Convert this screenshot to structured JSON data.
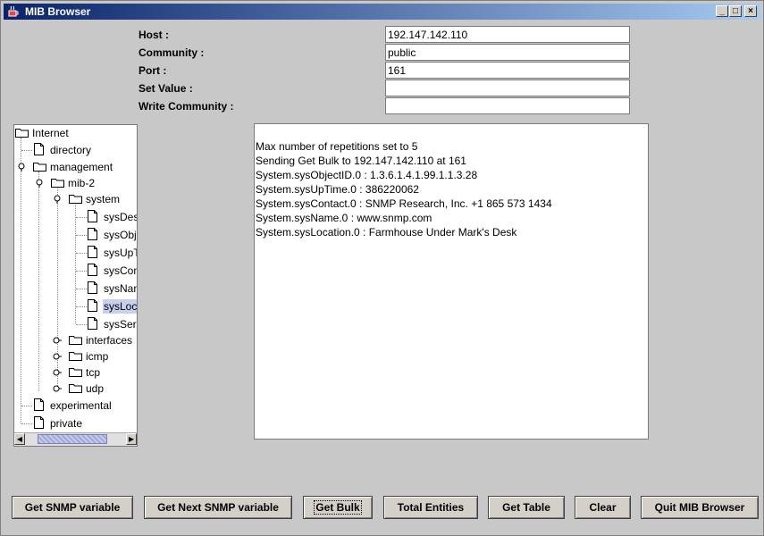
{
  "window": {
    "title": "MIB Browser"
  },
  "form": {
    "host_label": "Host :",
    "host_value": "192.147.142.110",
    "community_label": "Community :",
    "community_value": "public",
    "port_label": "Port :",
    "port_value": "161",
    "set_value_label": "Set Value :",
    "set_value_value": "",
    "write_community_label": "Write Community :",
    "write_community_value": ""
  },
  "tree": {
    "internet": "Internet",
    "directory": "directory",
    "management": "management",
    "mib2": "mib-2",
    "system": "system",
    "system_children": [
      "sysDes",
      "sysObj",
      "sysUpT",
      "sysCon",
      "sysNan",
      "sysLoc",
      "sysSer"
    ],
    "selected": "sysLoc",
    "interfaces": "interfaces",
    "icmp": "icmp",
    "tcp": "tcp",
    "udp": "udp",
    "experimental": "experimental",
    "private": "private"
  },
  "output": {
    "lines": [
      "Max number of repetitions set to 5",
      "Sending Get Bulk to 192.147.142.110 at 161",
      "System.sysObjectID.0 : 1.3.6.1.4.1.99.1.1.3.28",
      "System.sysUpTime.0 : 386220062",
      "System.sysContact.0 : SNMP Research, Inc.  +1 865 573 1434",
      "System.sysName.0 : www.snmp.com",
      "System.sysLocation.0 : Farmhouse Under Mark's Desk"
    ]
  },
  "buttons": {
    "get_snmp": "Get SNMP variable",
    "get_next": "Get Next SNMP variable",
    "get_bulk": "Get Bulk",
    "total_entities": "Total Entities",
    "get_table": "Get Table",
    "clear": "Clear",
    "quit": "Quit MIB Browser"
  },
  "icons": {
    "app": "coffee-cup-icon",
    "folder": "folder-icon",
    "leaf": "document-icon",
    "expander": "tree-handle-icon"
  },
  "colors": {
    "title_start": "#0a246a",
    "title_end": "#a6caf0",
    "selection": "#c8d0f0"
  }
}
